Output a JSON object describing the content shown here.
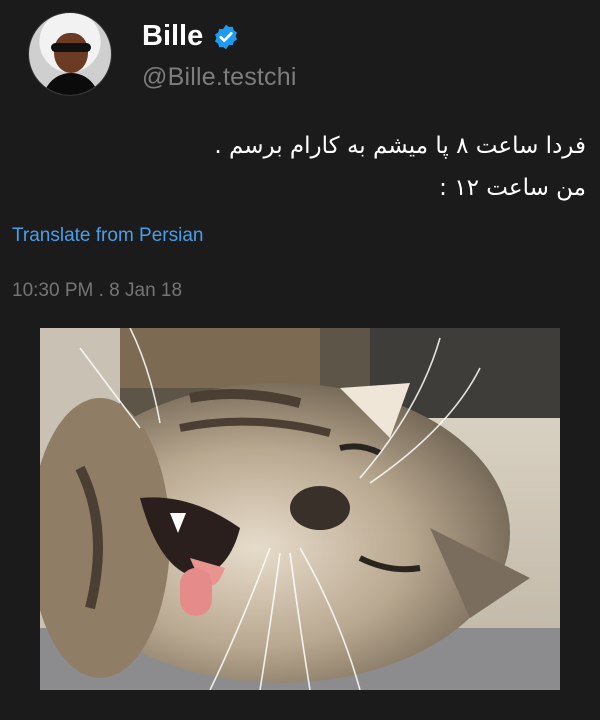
{
  "user": {
    "display_name": "Bille",
    "handle": "@Bille.testchi",
    "avatar_icon": "profile-avatar",
    "verified_icon": "verified-badge-icon",
    "verified_color": "#1d9bf0"
  },
  "tweet": {
    "lines": [
      "فردا ساعت ۸ پا میشم به کارام برسم .",
      "من ساعت ۱۲ :"
    ],
    "translate_label": "Translate from Persian",
    "timestamp": "10:30 PM . 8 Jan 18",
    "media": "photo of a sleeping tabby cat with mouth open"
  },
  "colors": {
    "background": "#1b1b1b",
    "link": "#4a9ee8",
    "muted": "#757575"
  }
}
